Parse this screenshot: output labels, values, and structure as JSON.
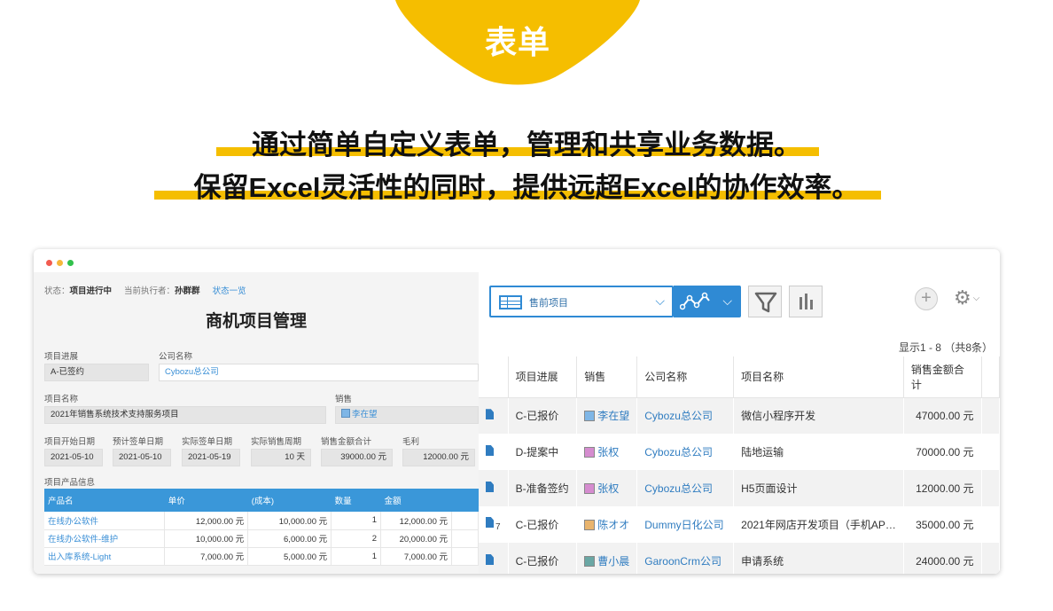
{
  "banner": {
    "badge": "表单",
    "headline1": "通过简单自定义表单，管理和共享业务数据。",
    "headline2": "保留Excel灵活性的同时，提供远超Excel的协作效率。",
    "accent": "#f5be00"
  },
  "form": {
    "status_label": "状态：",
    "status_value": "项目进行中",
    "assignee_label": "当前执行者：",
    "assignee_value": "孙群群",
    "status_link": "状态一览",
    "title": "商机项目管理",
    "fields": {
      "progress": {
        "label": "项目进展",
        "value": "A-已签约"
      },
      "company": {
        "label": "公司名称",
        "value": "Cybozu总公司"
      },
      "project_name": {
        "label": "项目名称",
        "value": "2021年销售系统技术支持服务项目"
      },
      "sales": {
        "label": "销售",
        "value": "李在望"
      },
      "start_date": {
        "label": "项目开始日期",
        "value": "2021-05-10"
      },
      "plan_sign_date": {
        "label": "预计签单日期",
        "value": "2021-05-10"
      },
      "actual_sign_date": {
        "label": "实际签单日期",
        "value": "2021-05-19"
      },
      "sales_cycle": {
        "label": "实际销售周期",
        "value": "10 天"
      },
      "total": {
        "label": "销售金额合计",
        "value": "39000.00 元"
      },
      "margin": {
        "label": "毛利",
        "value": "12000.00 元"
      }
    },
    "products": {
      "section_label": "项目产品信息",
      "headers": [
        "产品名",
        "单价",
        "(成本)",
        "数量",
        "金额"
      ],
      "rows": [
        [
          "在线办公软件",
          "12,000.00 元",
          "10,000.00 元",
          "1",
          "12,000.00 元"
        ],
        [
          "在线办公软件-维护",
          "10,000.00 元",
          "6,000.00 元",
          "2",
          "20,000.00 元"
        ],
        [
          "出入库系统-Light",
          "7,000.00 元",
          "5,000.00 元",
          "1",
          "7,000.00 元"
        ]
      ]
    }
  },
  "list": {
    "view_name": "售前项目",
    "pager": "显示1 - 8 （共8条）",
    "icons": {
      "view": "table-icon",
      "graph": "line-chart-icon",
      "filter": "funnel-icon",
      "summary": "bar-chart-icon",
      "add": "plus-icon",
      "settings": "gear-icon"
    },
    "headers": [
      "项目进展",
      "销售",
      "公司名称",
      "项目名称",
      "销售金额合计"
    ],
    "rows": [
      {
        "progress": "C-已报价",
        "sales": "李在望",
        "company": "Cybozu总公司",
        "project": "微信小程序开发",
        "amount": "47000.00 元",
        "badge": ""
      },
      {
        "progress": "D-提案中",
        "sales": "张权",
        "company": "Cybozu总公司",
        "project": "陆地运输",
        "amount": "70000.00 元",
        "badge": ""
      },
      {
        "progress": "B-准备签约",
        "sales": "张权",
        "company": "Cybozu总公司",
        "project": "H5页面设计",
        "amount": "12000.00 元",
        "badge": ""
      },
      {
        "progress": "C-已报价",
        "sales": "陈オオ",
        "company": "Dummy日化公司",
        "project": "2021年网店开发项目（手机AP…",
        "amount": "35000.00 元",
        "badge": "7"
      },
      {
        "progress": "C-已报价",
        "sales": "曹小晨",
        "company": "GaroonCrm公司",
        "project": "申请系统",
        "amount": "24000.00 元",
        "badge": ""
      }
    ]
  }
}
